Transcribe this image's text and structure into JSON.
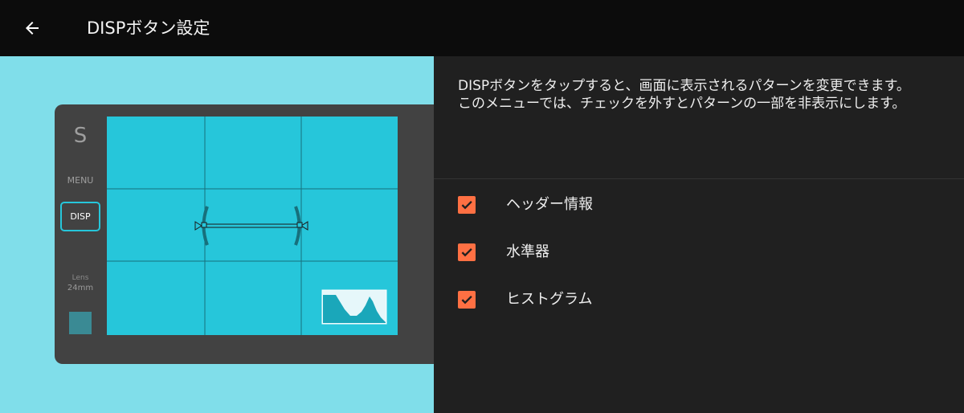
{
  "app_bar": {
    "title": "DISPボタン設定",
    "back_icon": "arrow-left-icon"
  },
  "preview": {
    "background": "#80deea",
    "screen_color": "#26c6da",
    "camera": {
      "mode": "S",
      "menu_label": "MENU",
      "disp_label": "DISP",
      "lens_label": "Lens",
      "lens_value": "24mm"
    }
  },
  "description": {
    "lines": [
      "DISPボタンをタップすると、画面に表示されるパターンを変更できます。",
      "このメニューでは、チェックを外すとパターンの一部を非表示にします。"
    ]
  },
  "options": [
    {
      "label": "ヘッダー情報",
      "checked": true
    },
    {
      "label": "水準器",
      "checked": true
    },
    {
      "label": "ヒストグラム",
      "checked": true
    }
  ],
  "colors": {
    "accent": "#ff7043",
    "highlight": "#26c6da",
    "appbar": "#0c0c0c",
    "panel": "#202020"
  }
}
